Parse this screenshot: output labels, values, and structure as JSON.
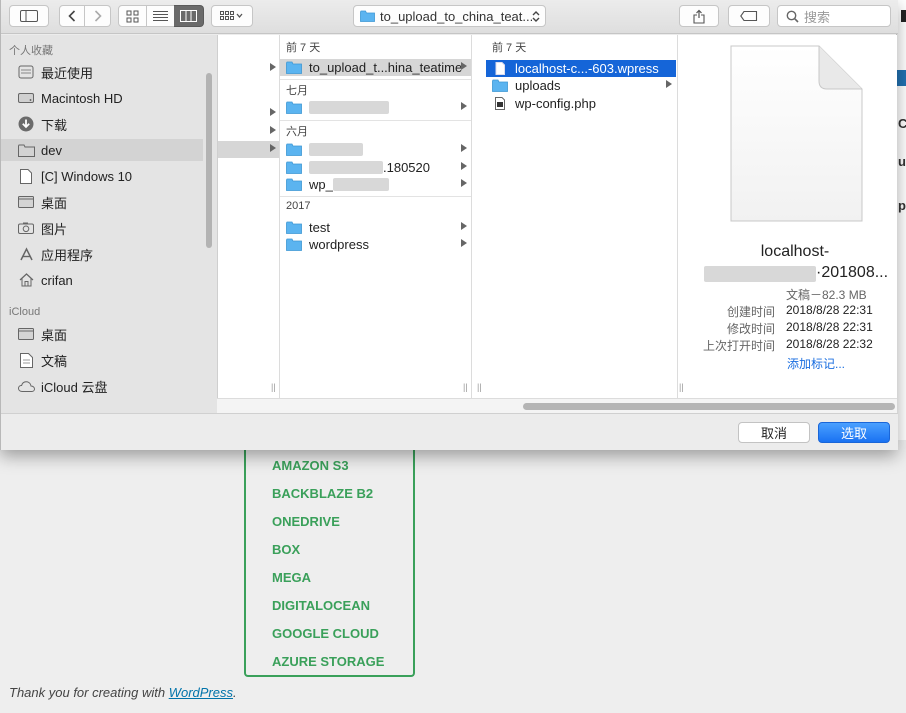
{
  "toolbar": {
    "path_label": "to_upload_to_china_teat...",
    "search_placeholder": "搜索"
  },
  "sidebar": {
    "sections": [
      {
        "title": "个人收藏"
      },
      {
        "title": "iCloud"
      }
    ],
    "favorites": [
      {
        "label": "最近使用",
        "icon": "recents-icon"
      },
      {
        "label": "Macintosh HD",
        "icon": "hard-drive-icon"
      },
      {
        "label": "下载",
        "icon": "downloads-icon"
      },
      {
        "label": "dev",
        "icon": "folder-icon"
      },
      {
        "label": "[C] Windows 10",
        "icon": "document-icon"
      },
      {
        "label": "桌面",
        "icon": "desktop-icon"
      },
      {
        "label": "图片",
        "icon": "camera-icon"
      },
      {
        "label": "应用程序",
        "icon": "applications-icon"
      },
      {
        "label": "crifan",
        "icon": "home-icon"
      }
    ],
    "icloud": [
      {
        "label": "桌面",
        "icon": "desktop-icon"
      },
      {
        "label": "文稿",
        "icon": "document-icon"
      },
      {
        "label": "iCloud 云盘",
        "icon": "cloud-icon"
      }
    ]
  },
  "column2": {
    "groups": [
      {
        "header": "前 7 天",
        "items": [
          {
            "name": "to_upload_t...hina_teatime"
          }
        ]
      },
      {
        "header": "七月",
        "items": [
          {
            "name": ""
          }
        ]
      },
      {
        "header": "六月",
        "items": [
          {
            "name": ""
          },
          {
            "name": ".180520"
          },
          {
            "name": "wp_"
          }
        ]
      },
      {
        "header": "2017",
        "items": [
          {
            "name": "test"
          },
          {
            "name": "wordpress"
          }
        ]
      }
    ]
  },
  "column3": {
    "header": "前 7 天",
    "items": [
      {
        "name": "localhost-c...-603.wpress"
      },
      {
        "name": "uploads"
      },
      {
        "name": "wp-config.php"
      }
    ]
  },
  "preview": {
    "name_line1": "localhost-",
    "name_line2": "·201808...",
    "kind_size": "文稿－82.3 MB",
    "created_label": "创建时间",
    "created_value": "2018/8/28 22:31",
    "modified_label": "修改时间",
    "modified_value": "2018/8/28 22:31",
    "opened_label": "上次打开时间",
    "opened_value": "2018/8/28 22:32",
    "add_tags": "添加标记..."
  },
  "buttons": {
    "cancel": "取消",
    "choose": "选取"
  },
  "wp_page": {
    "services": [
      "AMAZON S3",
      "BACKBLAZE B2",
      "ONEDRIVE",
      "BOX",
      "MEGA",
      "DIGITALOCEAN",
      "GOOGLE CLOUD",
      "AZURE STORAGE"
    ],
    "footer_prefix": "Thank you for creating with ",
    "footer_link": "WordPress",
    "footer_suffix": ".",
    "edge_fragments": [
      "C",
      "ug",
      "p"
    ]
  },
  "colors": {
    "accent_blue": "#1565d8",
    "wp_green": "#3aa05a",
    "folder_blue": "#5bb4f0"
  }
}
